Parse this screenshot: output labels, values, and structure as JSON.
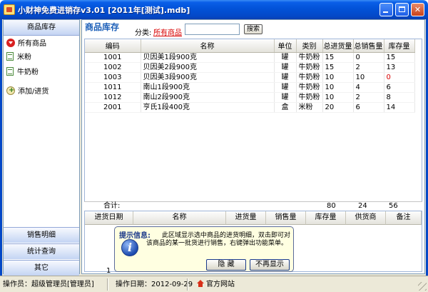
{
  "window": {
    "title": "小财神免费进销存v3.01 [2011年[测试].mdb]",
    "minimize_glyph": "_",
    "maximize_glyph": "□",
    "close_glyph": "✕"
  },
  "sidebar": {
    "header": "商品库存",
    "items": [
      {
        "label": "所有商品",
        "icon": "red-down-arrow-icon"
      },
      {
        "label": "米粉",
        "icon": "document-icon"
      },
      {
        "label": "牛奶粉",
        "icon": "document-icon"
      },
      {
        "label": "添加/进货",
        "icon": "add-icon"
      }
    ],
    "bottom_buttons": [
      "销售明细",
      "统计查询",
      "其它"
    ]
  },
  "main": {
    "title": "商品库存",
    "category_label": "分类:",
    "category_value": "所有商品",
    "search_value": "",
    "search_button": "搜索",
    "columns": [
      "编码",
      "名称",
      "单位",
      "类别",
      "总进货量",
      "总销售量",
      "库存量"
    ],
    "rows": [
      [
        "1001",
        "贝因美1段900克",
        "罐",
        "牛奶粉",
        "15",
        "0",
        "15"
      ],
      [
        "1002",
        "贝因美2段900克",
        "罐",
        "牛奶粉",
        "15",
        "2",
        "13"
      ],
      [
        "1003",
        "贝因美3段900克",
        "罐",
        "牛奶粉",
        "10",
        "10",
        "0"
      ],
      [
        "1011",
        "南山1段900克",
        "罐",
        "牛奶粉",
        "10",
        "4",
        "6"
      ],
      [
        "1012",
        "南山2段900克",
        "罐",
        "牛奶粉",
        "10",
        "2",
        "8"
      ],
      [
        "2001",
        "亨氏1段400克",
        "盒",
        "米粉",
        "20",
        "6",
        "14"
      ]
    ],
    "totals": {
      "label": "合计:",
      "in": "80",
      "out": "24",
      "stock": "56"
    }
  },
  "purchase_detail": {
    "columns": [
      "进货日期",
      "名称",
      "进货量",
      "销售量",
      "库存量",
      "供货商",
      "备注"
    ],
    "row_number": "1"
  },
  "tooltip": {
    "title": "提示信息:",
    "message": "此区域显示选中商品的进货明细，双击即可对该商品的某一批货进行销售，右键弹出功能菜单。",
    "hide_button": "隐 藏",
    "dont_show_button": "不再显示"
  },
  "status": {
    "operator": "操作员：超级管理员[管理员]",
    "date": "操作日期：2012-09-29",
    "website": "官方网站"
  },
  "colors": {
    "titlebar": "#0252d8",
    "accent_text": "#1c5fb8",
    "warning_red": "#d80000",
    "tooltip_bg": "#ffffe1"
  }
}
